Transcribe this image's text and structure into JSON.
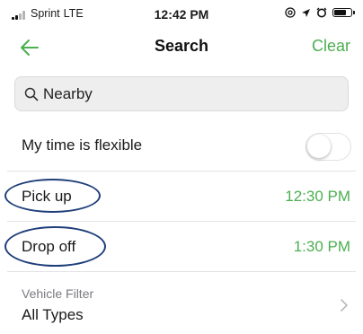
{
  "colors": {
    "accent": "#4caf50",
    "annotation": "#1f3f7a",
    "text": "#1a1a1a",
    "secondary_text": "#7a7a80"
  },
  "status_bar": {
    "carrier": "Sprint",
    "network": "LTE",
    "time": "12:42 PM",
    "signal_bars": 4,
    "signal_bars_active": 2,
    "battery_level": 0.8,
    "icons": [
      "at-icon",
      "location-arrow-icon",
      "alarm-icon",
      "battery-icon"
    ]
  },
  "nav": {
    "back_icon": "back-arrow-icon",
    "title": "Search",
    "clear_label": "Clear"
  },
  "search": {
    "icon": "search-icon",
    "value": "Nearby"
  },
  "flexible": {
    "label": "My time is flexible",
    "enabled": false
  },
  "pickup": {
    "label": "Pick up",
    "time": "12:30 PM"
  },
  "dropoff": {
    "label": "Drop off",
    "time": "1:30 PM"
  },
  "vehicle_filter": {
    "label": "Vehicle Filter",
    "value": "All Types",
    "icon": "chevron-right-icon"
  }
}
